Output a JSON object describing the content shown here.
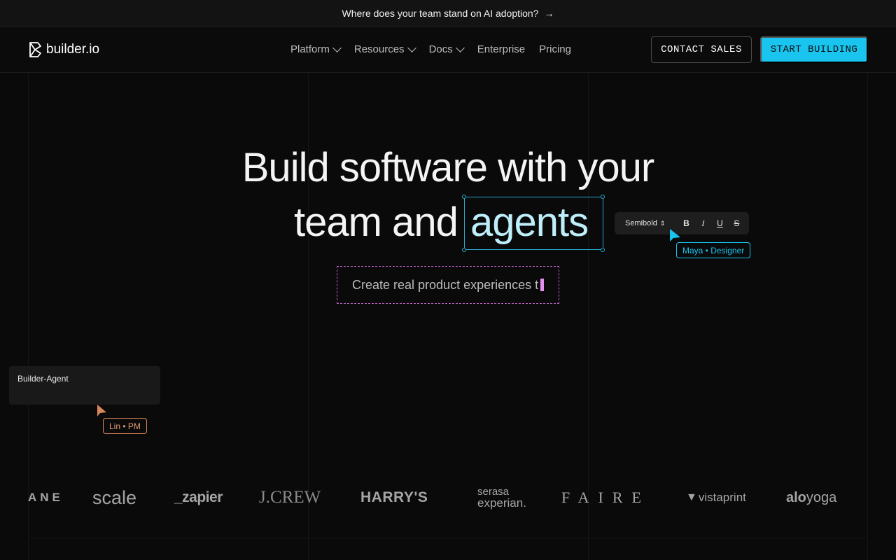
{
  "banner": {
    "text": "Where does your team stand on AI adoption?",
    "arrow": "→"
  },
  "nav": {
    "brand": "builder.io",
    "menu": [
      {
        "label": "Platform",
        "has_dropdown": true
      },
      {
        "label": "Resources",
        "has_dropdown": true
      },
      {
        "label": "Docs",
        "has_dropdown": true
      },
      {
        "label": "Enterprise",
        "has_dropdown": false
      },
      {
        "label": "Pricing",
        "has_dropdown": false
      }
    ],
    "contact_label": "CONTACT SALES",
    "start_label": "START BUILDING"
  },
  "hero": {
    "line1": "Build software with your",
    "line2_prefix": "team and",
    "highlight": "agents",
    "subtitle_typing": "Create real product experiences t"
  },
  "format_toolbar": {
    "font_weight": "Semibold",
    "stepper_glyph": "⇕",
    "bold": "B",
    "italic": "I",
    "underline": "U",
    "strike": "S"
  },
  "cursors": {
    "designer": "Maya • Designer",
    "pm": "Lin • PM"
  },
  "agent_card": {
    "title": "Builder-Agent"
  },
  "customer_logos": [
    "ANE",
    "scale",
    "_zapier",
    "J.CREW",
    "HARRY'S",
    "serasa",
    "experian.",
    "FAIRE",
    "vistaprint",
    "alo",
    "yoga"
  ],
  "colors": {
    "accent": "#19c4ef",
    "designer_cursor": "#19c4ef",
    "pm_cursor": "#d9865a",
    "typing_border": "#c063c9"
  }
}
